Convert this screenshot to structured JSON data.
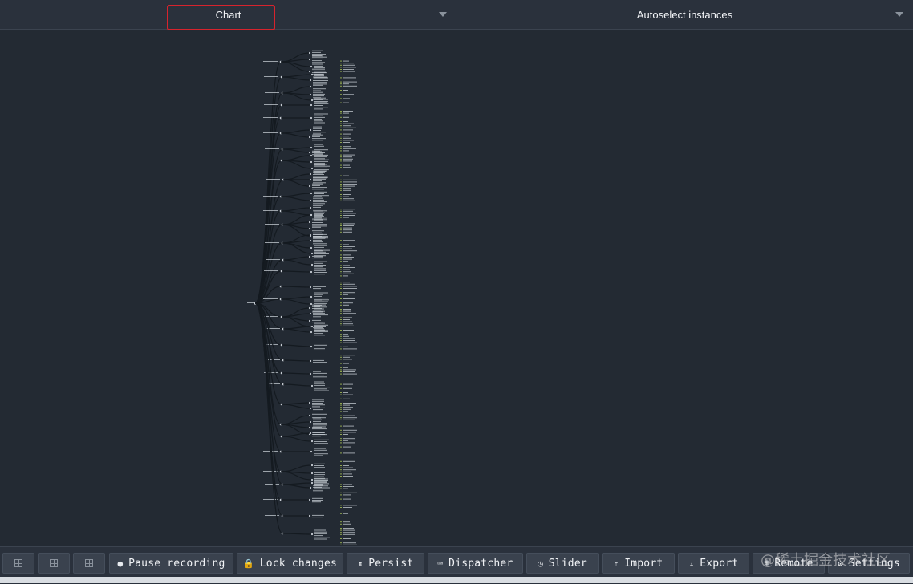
{
  "topbar": {
    "monitor_select": {
      "value": "Chart"
    },
    "instance_select": {
      "value": "Autoselect instances"
    }
  },
  "toolbar": {
    "layout_buttons": [
      {
        "icon": "layout-vertical-icon"
      },
      {
        "icon": "layout-horizontal-icon"
      },
      {
        "icon": "layout-window-icon"
      }
    ],
    "buttons": [
      {
        "id": "pause",
        "label": "Pause recording",
        "icon": "record-icon",
        "glyph": "●"
      },
      {
        "id": "lock",
        "label": "Lock changes",
        "icon": "lock-icon",
        "glyph": "🔒"
      },
      {
        "id": "persist",
        "label": "Persist",
        "icon": "pin-icon",
        "glyph": "⇟"
      },
      {
        "id": "dispatcher",
        "label": "Dispatcher",
        "icon": "keyboard-icon",
        "glyph": "⌨"
      },
      {
        "id": "slider",
        "label": "Slider",
        "icon": "clock-icon",
        "glyph": "◷"
      },
      {
        "id": "import",
        "label": "Import",
        "icon": "upload-icon",
        "glyph": "⇡"
      },
      {
        "id": "export",
        "label": "Export",
        "icon": "download-icon",
        "glyph": "⇣"
      },
      {
        "id": "remote",
        "label": "Remote",
        "icon": "remote-icon",
        "glyph": "⩩"
      },
      {
        "id": "settings",
        "label": "Settings",
        "icon": "gear-icon",
        "glyph": "⚙"
      }
    ]
  },
  "watermark": "@稀土掘金技术社区",
  "colors": {
    "background": "#232a33",
    "bar": "#2a313c",
    "button": "#3a424e",
    "highlight": "#d6232d",
    "node": "#c7cdd4",
    "leaf": "#b6d05a",
    "link": "#141a20"
  }
}
